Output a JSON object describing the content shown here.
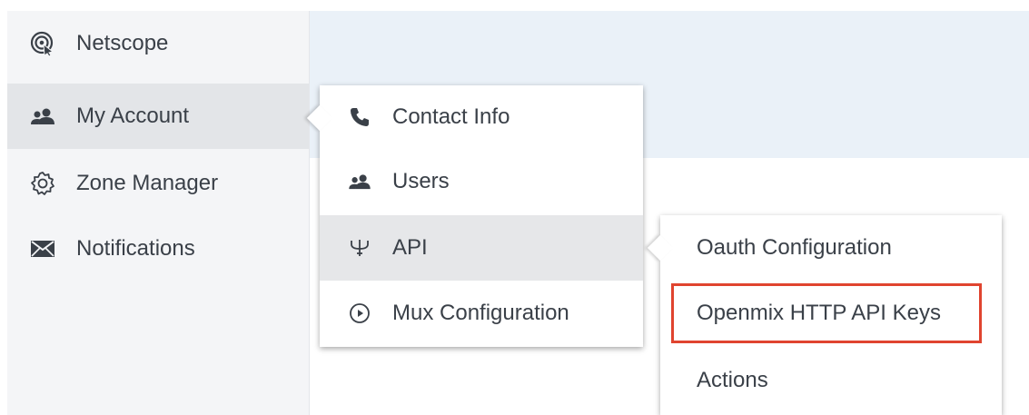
{
  "sidebar": {
    "items": [
      {
        "label": "Netscope",
        "icon": "netscope-icon"
      },
      {
        "label": "My Account",
        "icon": "users-icon",
        "active": true
      },
      {
        "label": "Zone Manager",
        "icon": "gear-icon"
      },
      {
        "label": "Notifications",
        "icon": "envelope-icon"
      }
    ]
  },
  "submenu": {
    "items": [
      {
        "label": "Contact Info",
        "icon": "phone-icon"
      },
      {
        "label": "Users",
        "icon": "users-icon"
      },
      {
        "label": "API",
        "icon": "api-icon",
        "active": true
      },
      {
        "label": "Mux Configuration",
        "icon": "play-circle-icon"
      }
    ]
  },
  "api_menu": {
    "items": [
      {
        "label": "Oauth Configuration"
      },
      {
        "label": "Openmix HTTP API Keys",
        "highlighted": true
      },
      {
        "label": "Actions"
      }
    ]
  },
  "colors": {
    "sidebar_bg": "#f4f5f7",
    "active_bg": "#e3e5e8",
    "top_band": "#eaf1f8",
    "highlight": "#e0442f",
    "text": "#3a4048"
  }
}
